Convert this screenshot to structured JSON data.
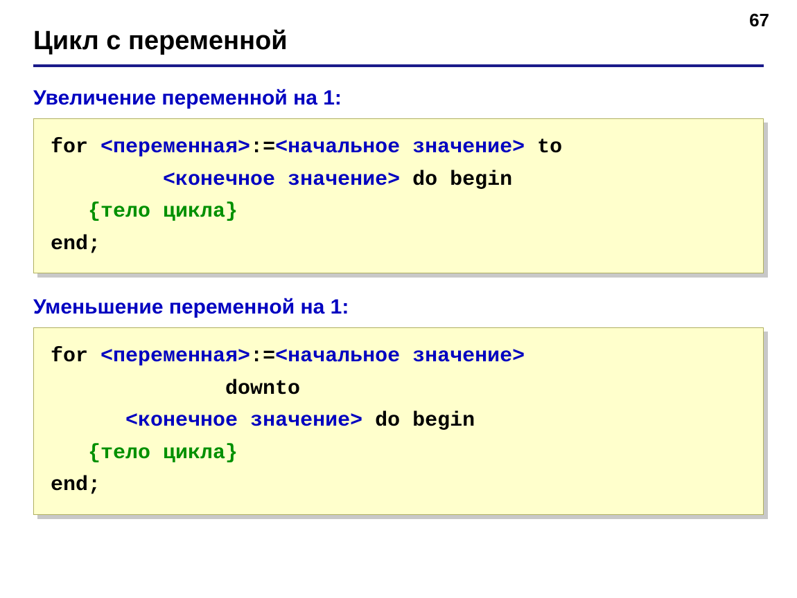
{
  "page_number": "67",
  "title": "Цикл с переменной",
  "section1": {
    "heading": "Увеличение переменной на 1:",
    "code": {
      "for": "for ",
      "var": "<переменная>",
      "assign": ":=",
      "start": "<начальное значение>",
      "to": " to",
      "end_val": "<конечное значение>",
      "do_begin": " do begin",
      "body": "{тело цикла}",
      "end": "end;"
    }
  },
  "section2": {
    "heading": "Уменьшение переменной на 1:",
    "code": {
      "for": "for ",
      "var": "<переменная>",
      "assign": ":=",
      "start": "<начальное значение>",
      "downto": "downto",
      "end_val": "<конечное значение>",
      "do_begin": " do begin",
      "body": "{тело цикла}",
      "end": "end;"
    }
  }
}
